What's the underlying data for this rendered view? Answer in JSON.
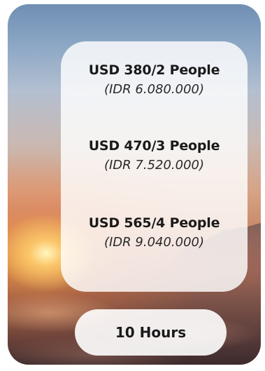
{
  "prices": [
    {
      "main": "USD 380/2 People",
      "sub": "(IDR 6.080.000)"
    },
    {
      "main": "USD 470/3 People",
      "sub": "(IDR 7.520.000)"
    },
    {
      "main": "USD 565/4 People",
      "sub": "(IDR 9.040.000)"
    }
  ],
  "duration": {
    "label": "10 Hours"
  },
  "colors": {
    "panel": "#ffffff",
    "text": "#1a1a1a",
    "sky_top": "#6f8fb3",
    "sunset": "#ffaa3c"
  }
}
